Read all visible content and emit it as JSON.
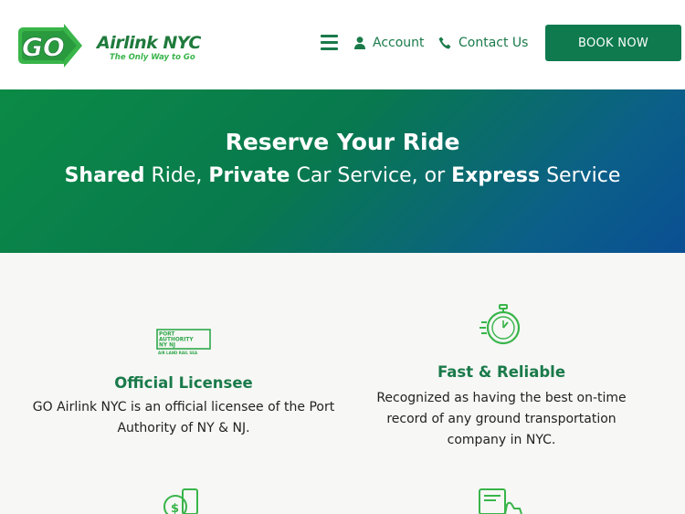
{
  "header": {
    "logo": {
      "mark": "GO",
      "name": "Airlink NYC",
      "tagline": "The Only Way to Go"
    },
    "nav": {
      "menu_icon": "hamburger-menu-icon",
      "account_label": "Account",
      "account_icon": "user-icon",
      "contact_label": "Contact Us",
      "contact_icon": "phone-icon"
    },
    "book_now_label": "BOOK NOW"
  },
  "hero": {
    "title": "Reserve Your Ride",
    "subtitle": {
      "part1_bold": "Shared",
      "part1": " Ride, ",
      "part2_bold": "Private",
      "part2": " Car Service, or ",
      "part3_bold": "Express",
      "part3": " Service"
    }
  },
  "features": [
    {
      "icon": "port-authority-logo",
      "logo_lines": [
        "PORT",
        "AUTHORITY",
        "NY NJ",
        "AIR LAND RAIL SEA"
      ],
      "title": "Official Licensee",
      "text_lines": [
        "GO Airlink NYC is an official licensee of the Port",
        "Authority of NY & NJ."
      ]
    },
    {
      "icon": "stopwatch-icon",
      "title": "Fast & Reliable",
      "text_lines": [
        "Recognized as having the best on-time",
        "record of any ground transportation",
        "company in NYC."
      ]
    }
  ],
  "colors": {
    "brand_green": "#0e7a4e",
    "accent_green": "#39b54a",
    "hero_blue": "#0a4f93"
  }
}
